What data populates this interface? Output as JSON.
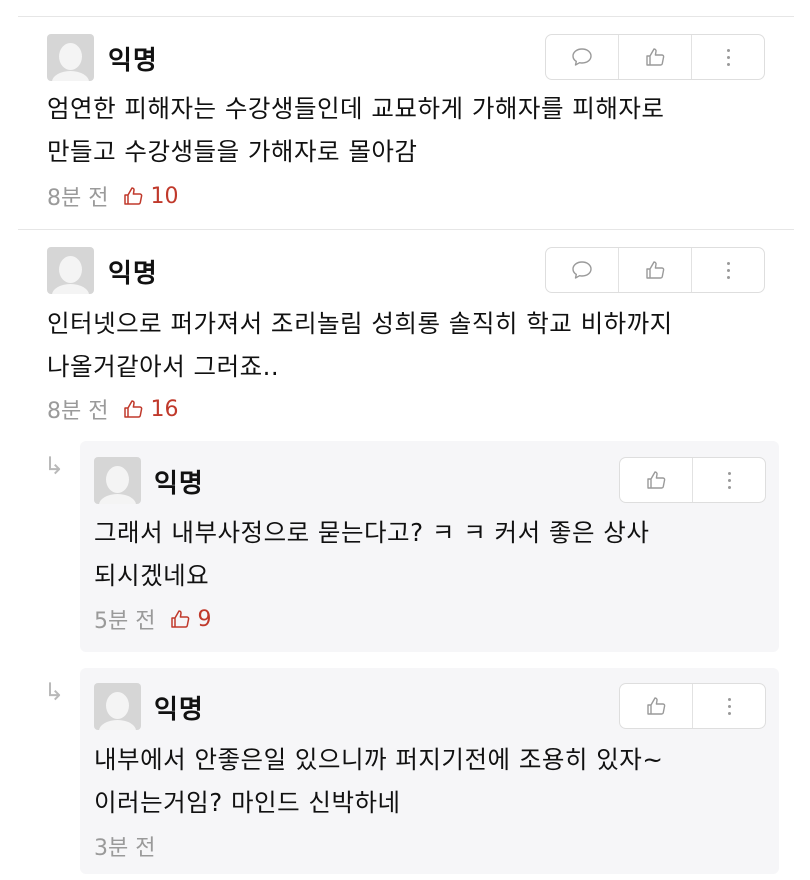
{
  "comments": [
    {
      "author": "익명",
      "line1": "엄연한 피해자는 수강생들인데 교묘하게 가해자를 피해자로",
      "line2": "만들고 수강생들을 가해자로 몰아감",
      "time": "8분 전",
      "likes": "10",
      "icons": [
        "comment-icon",
        "thumbs-up-icon",
        "more-icon"
      ]
    },
    {
      "author": "익명",
      "line1": "인터넷으로 퍼가져서 조리놀림 성희롱 솔직히 학교 비하까지",
      "line2": "나올거같아서 그러죠..",
      "time": "8분 전",
      "likes": "16",
      "icons": [
        "comment-icon",
        "thumbs-up-icon",
        "more-icon"
      ]
    }
  ],
  "replies": [
    {
      "author": "익명",
      "line1": "그래서 내부사정으로 묻는다고? ㅋ ㅋ  커서 좋은 상사",
      "line2": "되시겠네요",
      "time": "5분 전",
      "likes": "9",
      "icons": [
        "thumbs-up-icon",
        "more-icon"
      ]
    },
    {
      "author": "익명",
      "line1": "내부에서 안좋은일 있으니까 퍼지기전에 조용히 있자~",
      "line2": "이러는거임? 마인드 신박하네",
      "time": "3분 전",
      "icons": [
        "thumbs-up-icon",
        "more-icon"
      ]
    }
  ],
  "colors": {
    "like": "#c0392b",
    "meta": "#9a9a9a",
    "reply_bg": "#f6f6f8"
  }
}
